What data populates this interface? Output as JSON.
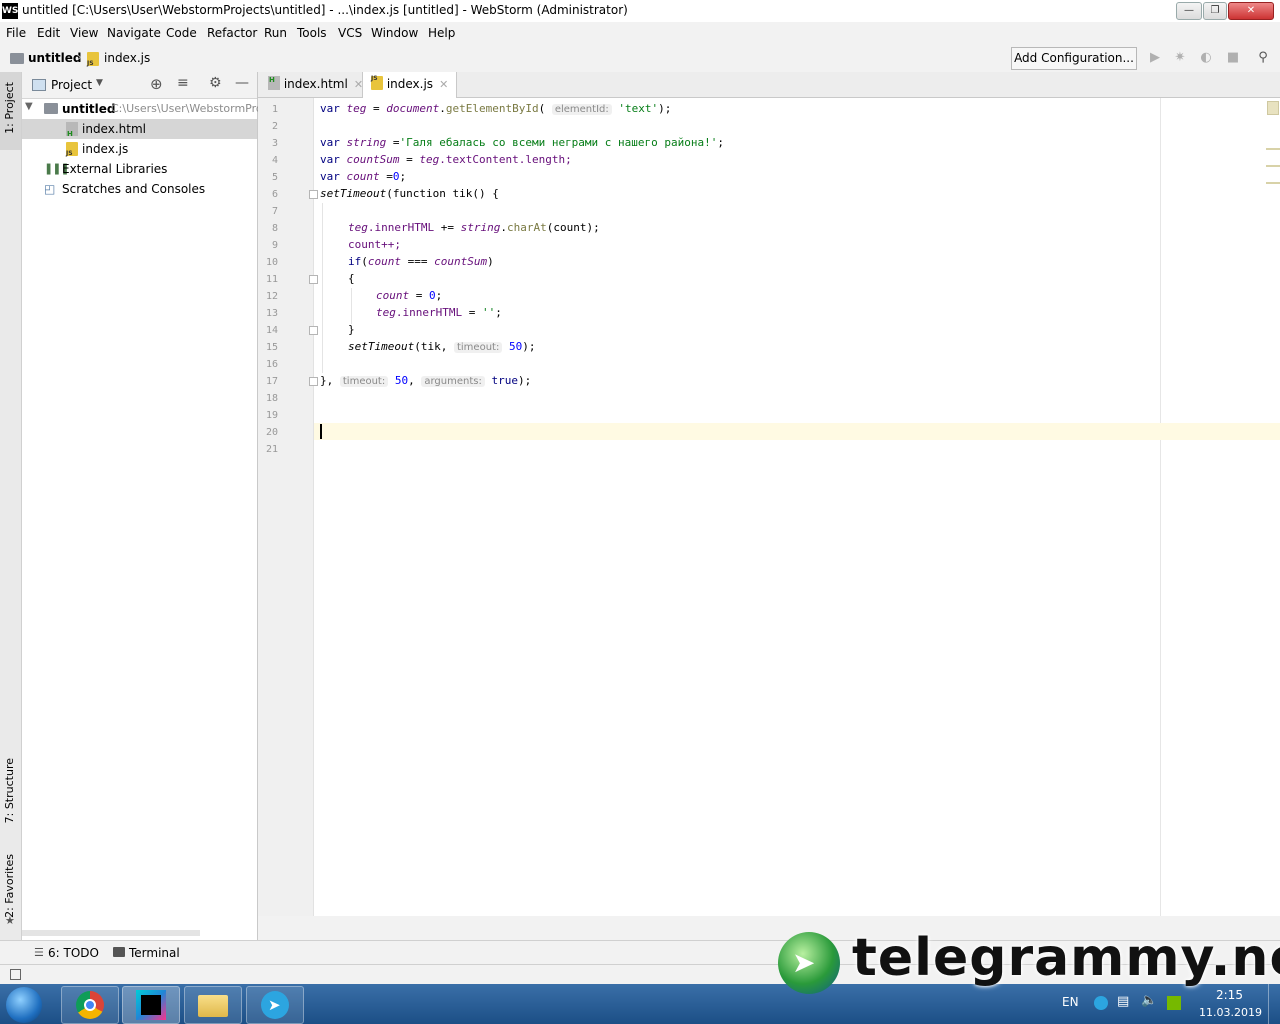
{
  "window": {
    "title": "untitled [C:\\Users\\User\\WebstormProjects\\untitled] - ...\\index.js [untitled] - WebStorm (Administrator)",
    "app_icon": "WS"
  },
  "menu": [
    "File",
    "Edit",
    "View",
    "Navigate",
    "Code",
    "Refactor",
    "Run",
    "Tools",
    "VCS",
    "Window",
    "Help"
  ],
  "navbar": {
    "breadcrumb_project": "untitled",
    "breadcrumb_file": "index.js",
    "add_configuration": "Add Configuration..."
  },
  "sidebar_tabs": {
    "project": "1: Project",
    "structure": "7: Structure",
    "favorites": "2: Favorites"
  },
  "project_panel": {
    "title": "Project",
    "root_name": "untitled",
    "root_path": "C:\\Users\\User\\WebstormPro",
    "files": [
      "index.html",
      "index.js"
    ],
    "external": "External Libraries",
    "scratches": "Scratches and Consoles"
  },
  "tabs": [
    {
      "label": "index.html"
    },
    {
      "label": "index.js"
    }
  ],
  "editor": {
    "line_numbers": [
      "1",
      "2",
      "3",
      "4",
      "5",
      "6",
      "7",
      "8",
      "9",
      "10",
      "11",
      "12",
      "13",
      "14",
      "15",
      "16",
      "17",
      "18",
      "19",
      "20",
      "21"
    ],
    "hints": {
      "elementId": "elementId:",
      "timeout": "timeout:",
      "arguments": "arguments:"
    },
    "tokens": {
      "var": "var",
      "teg": "teg",
      "eq": " = ",
      "document": "document",
      "getById": "getElementById",
      "open_paren": "(",
      "text_str": "'text'",
      "close_semi": ");",
      "string": "string",
      "string_val": "'Галя ебалась со всеми неграми с нашего района!'",
      "eq_nospace": " =",
      "countSum": "countSum",
      "textContent": ".textContent.length;",
      "count": "count",
      "zero": "0",
      "setTimeout": "setTimeout",
      "function_tik": "(function tik() {",
      "innerHTML": ".innerHTML",
      "plus_eq": " += ",
      "charAt": "charAt",
      "count_arg": "(count);",
      "countpp": "count++;",
      "if": "if",
      "strict_eq": " === ",
      "close_paren": ")",
      "lbrace": "{",
      "rbrace": "}",
      "empty_str": "''",
      "semi": ";",
      "tik": "(tik, ",
      "fifty": "50",
      "end_paren": ");",
      "close_fn": "}, ",
      "comma_sp": ", ",
      "true": "true",
      "spacer": " "
    }
  },
  "bottom_tools": {
    "todo": "6: TODO",
    "terminal": "Terminal"
  },
  "taskbar": {
    "lang": "EN",
    "time": "2:15",
    "date": "11.03.2019"
  },
  "watermark": "telegrammy.net",
  "colors": {
    "accent": "#3a6fa8",
    "string_green": "#067d17",
    "keyword_navy": "#000080",
    "caret_line": "#fffae3"
  }
}
